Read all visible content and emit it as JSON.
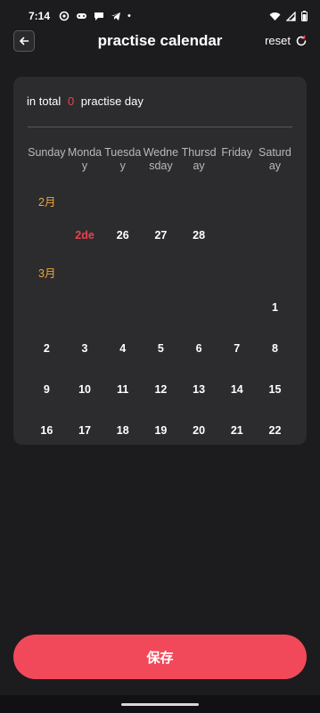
{
  "status_bar": {
    "time": "7:14",
    "dot": "•"
  },
  "header": {
    "title": "practise calendar",
    "reset_label": "reset"
  },
  "summary": {
    "prefix": "in total",
    "count": "0",
    "suffix": "practise day"
  },
  "weekdays": [
    "Sunday",
    "Monday",
    "Tuesday",
    "Wednesday",
    "Thursday",
    "Friday",
    "Saturday"
  ],
  "months": [
    {
      "label": "2月",
      "rows": [
        [
          "",
          "2de",
          "26",
          "27",
          "28",
          "",
          ""
        ]
      ]
    },
    {
      "label": "3月",
      "rows": [
        [
          "",
          "",
          "",
          "",
          "",
          "",
          "1"
        ],
        [
          "2",
          "3",
          "4",
          "5",
          "6",
          "7",
          "8"
        ],
        [
          "9",
          "10",
          "11",
          "12",
          "13",
          "14",
          "15"
        ],
        [
          "16",
          "17",
          "18",
          "19",
          "20",
          "21",
          "22"
        ]
      ]
    }
  ],
  "highlight_color": "#e8434f",
  "month_color": "#f0a534",
  "save_button": {
    "label": "保存",
    "color": "#f2495a"
  }
}
